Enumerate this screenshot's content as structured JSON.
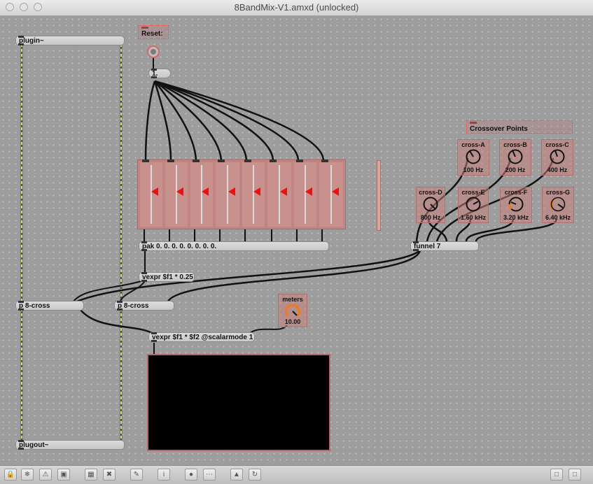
{
  "window": {
    "title": "8BandMix-V1.amxd (unlocked)"
  },
  "patch": {
    "plugin": "plugin~",
    "plugout": "plugout~",
    "reset_label": "Reset:",
    "message_one": "1.",
    "pak": "pak 0. 0. 0. 0. 0. 0. 0. 0.",
    "vexpr_gain": "vexpr $f1 * 0.25",
    "cross_left": "p 8-cross",
    "cross_right": "p 8-cross",
    "vexpr_scalar": "vexpr $f1 * $f2 @scalarmode 1",
    "funnel": "funnel 7",
    "crossover_comment": "Crossover Points",
    "slider_count": 8
  },
  "dials": {
    "a": {
      "label": "cross-A",
      "value": "100 Hz"
    },
    "b": {
      "label": "cross-B",
      "value": "200 Hz"
    },
    "c": {
      "label": "cross-C",
      "value": "400 Hz"
    },
    "d": {
      "label": "cross-D",
      "value": "800 Hz"
    },
    "e": {
      "label": "cross-E",
      "value": "1.60 kHz"
    },
    "f": {
      "label": "cross-F",
      "value": "3.20 kHz"
    },
    "g": {
      "label": "cross-G",
      "value": "6.40 kHz"
    },
    "meters": {
      "label": "meters",
      "value": "10.00"
    }
  },
  "toolbar": {
    "buttons": [
      "lock-icon",
      "snowflake-icon",
      "warning-icon",
      "presentation-icon",
      "grid-icon",
      "close-box-icon",
      "edit-icon",
      "info-icon",
      "inlet-icon",
      "matrix-icon",
      "hierarchy-icon",
      "refresh-icon",
      "left-panel-icon",
      "right-panel-icon"
    ]
  },
  "colors": {
    "accent_orange": "#f07a1a",
    "slider_marker": "#ee1111",
    "patch_cord": "#111111",
    "signal_cord": "#c8e070"
  }
}
